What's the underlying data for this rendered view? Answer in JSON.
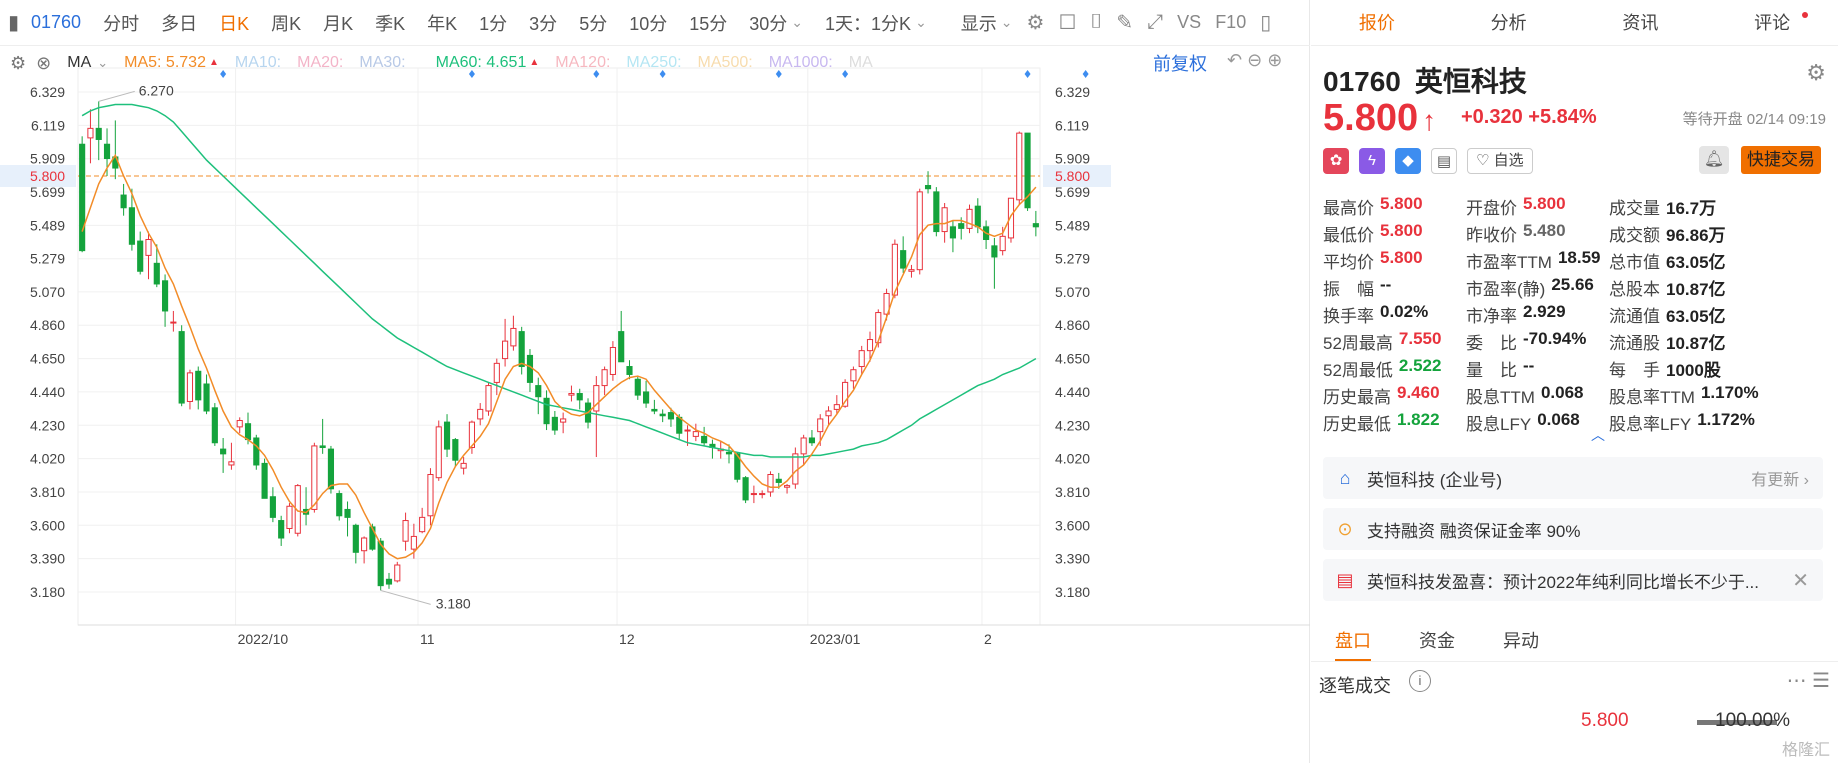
{
  "toolbar": {
    "code": "01760",
    "tabs": [
      "分时",
      "多日",
      "日K",
      "周K",
      "月K",
      "季K",
      "年K",
      "1分",
      "3分",
      "5分",
      "10分",
      "15分",
      "30分"
    ],
    "active": "日K",
    "period": "1天：1分K",
    "display": "显示",
    "vs": "VS",
    "f10": "F10"
  },
  "ma_legend": {
    "type": "MA",
    "ma5": "MA5: 5.732",
    "ma10": "MA10:",
    "ma20": "MA20:",
    "ma30": "MA30:",
    "ma60": "MA60: 4.651",
    "ma120": "MA120:",
    "ma250": "MA250:",
    "ma500": "MA500:",
    "ma1000": "MA1000:",
    "ma_trunc": "MA",
    "fuquan": "前复权",
    "colors": {
      "ma5": "#f28c28",
      "ma10": "#b7d5ef",
      "ma20": "#f3b4c8",
      "ma30": "#b8c9e6",
      "ma60": "#1ec07c",
      "ma120": "#f6b8c0",
      "ma250": "#b5e6f3",
      "ma500": "#f7dcae",
      "ma1000": "#c8b8f0"
    }
  },
  "chart_data": {
    "type": "candlestick",
    "yticks": [
      "6.329",
      "6.119",
      "5.909",
      "5.699",
      "5.489",
      "5.279",
      "5.070",
      "4.860",
      "4.650",
      "4.440",
      "4.230",
      "4.020",
      "3.810",
      "3.600",
      "3.390",
      "3.180"
    ],
    "ylim": [
      3.05,
      6.4
    ],
    "xticks": [
      {
        "label": "2022/10",
        "idx": 19
      },
      {
        "label": "11",
        "idx": 41
      },
      {
        "label": "12",
        "idx": 65
      },
      {
        "label": "2023/01",
        "idx": 88
      },
      {
        "label": "2",
        "idx": 109
      }
    ],
    "current_price_label": "5.800",
    "current_price": 5.8,
    "high_annotation": "6.270",
    "low_annotation": "3.180",
    "candles": [
      [
        6.0,
        6.05,
        5.32,
        5.33
      ],
      [
        6.04,
        6.22,
        5.88,
        6.1
      ],
      [
        6.1,
        6.27,
        5.9,
        6.03
      ],
      [
        6.0,
        6.1,
        5.8,
        5.91
      ],
      [
        5.92,
        6.15,
        5.78,
        5.85
      ],
      [
        5.68,
        5.75,
        5.55,
        5.6
      ],
      [
        5.6,
        5.72,
        5.33,
        5.37
      ],
      [
        5.39,
        5.45,
        5.18,
        5.2
      ],
      [
        5.3,
        5.45,
        5.15,
        5.4
      ],
      [
        5.25,
        5.37,
        5.1,
        5.12
      ],
      [
        5.14,
        5.18,
        4.85,
        4.95
      ],
      [
        4.88,
        4.95,
        4.82,
        4.88
      ],
      [
        4.82,
        4.86,
        4.35,
        4.37
      ],
      [
        4.38,
        4.58,
        4.33,
        4.56
      ],
      [
        4.57,
        4.6,
        4.33,
        4.39
      ],
      [
        4.49,
        4.55,
        4.3,
        4.32
      ],
      [
        4.34,
        4.37,
        4.1,
        4.12
      ],
      [
        4.08,
        4.15,
        3.93,
        4.05
      ],
      [
        3.98,
        4.12,
        3.95,
        4.0
      ],
      [
        4.22,
        4.28,
        4.18,
        4.26
      ],
      [
        4.24,
        4.31,
        4.11,
        4.14
      ],
      [
        4.15,
        4.17,
        3.95,
        3.98
      ],
      [
        3.99,
        4.02,
        3.77,
        3.77
      ],
      [
        3.78,
        3.84,
        3.62,
        3.65
      ],
      [
        3.63,
        3.66,
        3.47,
        3.52
      ],
      [
        3.58,
        3.74,
        3.55,
        3.72
      ],
      [
        3.55,
        3.86,
        3.53,
        3.85
      ],
      [
        3.7,
        3.84,
        3.6,
        3.67
      ],
      [
        3.7,
        4.12,
        3.68,
        4.1
      ],
      [
        4.1,
        4.27,
        4.05,
        4.09
      ],
      [
        4.08,
        4.1,
        3.8,
        3.83
      ],
      [
        3.8,
        3.82,
        3.63,
        3.66
      ],
      [
        3.7,
        3.75,
        3.53,
        3.65
      ],
      [
        3.6,
        3.61,
        3.36,
        3.43
      ],
      [
        3.44,
        3.53,
        3.36,
        3.52
      ],
      [
        3.59,
        3.61,
        3.44,
        3.45
      ],
      [
        3.5,
        3.52,
        3.19,
        3.22
      ],
      [
        3.26,
        3.3,
        3.2,
        3.23
      ],
      [
        3.25,
        3.37,
        3.24,
        3.35
      ],
      [
        3.5,
        3.68,
        3.44,
        3.63
      ],
      [
        3.45,
        3.61,
        3.39,
        3.53
      ],
      [
        3.56,
        3.71,
        3.55,
        3.65
      ],
      [
        3.66,
        3.96,
        3.6,
        3.92
      ],
      [
        3.9,
        4.26,
        3.88,
        4.22
      ],
      [
        4.25,
        4.3,
        4.03,
        4.08
      ],
      [
        4.14,
        4.15,
        3.97,
        4.01
      ],
      [
        3.96,
        4.03,
        3.92,
        3.99
      ],
      [
        4.09,
        4.26,
        4.05,
        4.25
      ],
      [
        4.27,
        4.37,
        4.23,
        4.33
      ],
      [
        4.32,
        4.5,
        4.29,
        4.48
      ],
      [
        4.5,
        4.65,
        4.42,
        4.62
      ],
      [
        4.65,
        4.9,
        4.6,
        4.76
      ],
      [
        4.73,
        4.92,
        4.7,
        4.84
      ],
      [
        4.82,
        4.85,
        4.55,
        4.6
      ],
      [
        4.67,
        4.71,
        4.44,
        4.5
      ],
      [
        4.48,
        4.53,
        4.3,
        4.41
      ],
      [
        4.4,
        4.45,
        4.2,
        4.24
      ],
      [
        4.28,
        4.32,
        4.17,
        4.2
      ],
      [
        4.25,
        4.31,
        4.18,
        4.27
      ],
      [
        4.42,
        4.48,
        4.38,
        4.43
      ],
      [
        4.43,
        4.46,
        4.33,
        4.39
      ],
      [
        4.37,
        4.4,
        4.21,
        4.25
      ],
      [
        4.32,
        4.54,
        4.03,
        4.48
      ],
      [
        4.48,
        4.6,
        4.42,
        4.58
      ],
      [
        4.55,
        4.76,
        4.51,
        4.72
      ],
      [
        4.82,
        4.95,
        4.65,
        4.63
      ],
      [
        4.6,
        4.64,
        4.52,
        4.55
      ],
      [
        4.52,
        4.54,
        4.39,
        4.42
      ],
      [
        4.44,
        4.51,
        4.34,
        4.37
      ],
      [
        4.33,
        4.39,
        4.3,
        4.32
      ],
      [
        4.3,
        4.33,
        4.25,
        4.29
      ],
      [
        4.31,
        4.34,
        4.22,
        4.27
      ],
      [
        4.28,
        4.3,
        4.14,
        4.18
      ],
      [
        4.2,
        4.23,
        4.1,
        4.2
      ],
      [
        4.16,
        4.24,
        4.13,
        4.19
      ],
      [
        4.16,
        4.22,
        4.1,
        4.12
      ],
      [
        4.11,
        4.14,
        4.02,
        4.09
      ],
      [
        4.07,
        4.13,
        4.02,
        4.08
      ],
      [
        4.06,
        4.11,
        3.99,
        4.05
      ],
      [
        4.05,
        4.06,
        3.87,
        3.89
      ],
      [
        3.9,
        3.91,
        3.74,
        3.76
      ],
      [
        3.8,
        3.85,
        3.74,
        3.8
      ],
      [
        3.8,
        3.82,
        3.77,
        3.8
      ],
      [
        3.81,
        3.94,
        3.78,
        3.92
      ],
      [
        3.89,
        3.93,
        3.83,
        3.87
      ],
      [
        3.84,
        3.86,
        3.8,
        3.85
      ],
      [
        3.86,
        4.09,
        3.83,
        4.05
      ],
      [
        4.05,
        4.17,
        3.98,
        4.15
      ],
      [
        4.15,
        4.2,
        4.1,
        4.12
      ],
      [
        4.19,
        4.3,
        4.1,
        4.27
      ],
      [
        4.29,
        4.35,
        4.23,
        4.32
      ],
      [
        4.33,
        4.42,
        4.3,
        4.36
      ],
      [
        4.35,
        4.52,
        4.34,
        4.5
      ],
      [
        4.51,
        4.6,
        4.46,
        4.58
      ],
      [
        4.6,
        4.73,
        4.55,
        4.7
      ],
      [
        4.7,
        4.82,
        4.63,
        4.77
      ],
      [
        4.75,
        4.96,
        4.72,
        4.94
      ],
      [
        4.93,
        5.09,
        4.89,
        5.06
      ],
      [
        5.05,
        5.4,
        5.03,
        5.37
      ],
      [
        5.33,
        5.42,
        5.19,
        5.22
      ],
      [
        5.2,
        5.24,
        5.16,
        5.21
      ],
      [
        5.21,
        5.72,
        5.18,
        5.7
      ],
      [
        5.74,
        5.83,
        5.69,
        5.72
      ],
      [
        5.7,
        5.73,
        5.42,
        5.45
      ],
      [
        5.45,
        5.63,
        5.38,
        5.6
      ],
      [
        5.48,
        5.52,
        5.32,
        5.41
      ],
      [
        5.5,
        5.54,
        5.4,
        5.47
      ],
      [
        5.47,
        5.62,
        5.44,
        5.59
      ],
      [
        5.61,
        5.66,
        5.44,
        5.48
      ],
      [
        5.48,
        5.52,
        5.34,
        5.4
      ],
      [
        5.36,
        5.41,
        5.09,
        5.29
      ],
      [
        5.33,
        5.48,
        5.3,
        5.42
      ],
      [
        5.41,
        5.66,
        5.38,
        5.66
      ],
      [
        5.65,
        6.08,
        5.62,
        6.07
      ],
      [
        6.07,
        6.07,
        5.58,
        5.6
      ],
      [
        5.5,
        5.58,
        5.42,
        5.48
      ]
    ],
    "ma5": [
      5.45,
      5.6,
      5.75,
      5.85,
      5.93,
      5.8,
      5.69,
      5.55,
      5.44,
      5.35,
      5.22,
      5.12,
      4.98,
      4.85,
      4.71,
      4.59,
      4.45,
      4.32,
      4.22,
      4.17,
      4.14,
      4.1,
      4.04,
      3.95,
      3.84,
      3.75,
      3.69,
      3.68,
      3.73,
      3.8,
      3.85,
      3.86,
      3.86,
      3.79,
      3.68,
      3.58,
      3.48,
      3.42,
      3.39,
      3.4,
      3.43,
      3.49,
      3.58,
      3.74,
      3.87,
      3.97,
      4.04,
      4.1,
      4.16,
      4.24,
      4.38,
      4.52,
      4.6,
      4.62,
      4.6,
      4.56,
      4.48,
      4.38,
      4.33,
      4.3,
      4.29,
      4.31,
      4.36,
      4.41,
      4.46,
      4.5,
      4.53,
      4.54,
      4.52,
      4.45,
      4.39,
      4.33,
      4.28,
      4.24,
      4.2,
      4.18,
      4.15,
      4.13,
      4.1,
      4.04,
      3.97,
      3.91,
      3.86,
      3.84,
      3.84,
      3.88,
      3.94,
      3.98,
      4.05,
      4.13,
      4.23,
      4.3,
      4.38,
      4.45,
      4.55,
      4.64,
      4.76,
      4.91,
      5.07,
      5.18,
      5.29,
      5.43,
      5.49,
      5.5,
      5.5,
      5.52,
      5.52,
      5.5,
      5.48,
      5.44,
      5.42,
      5.44,
      5.55,
      5.62,
      5.67,
      5.73
    ],
    "ma60": [
      6.18,
      6.21,
      6.23,
      6.24,
      6.25,
      6.25,
      6.25,
      6.24,
      6.23,
      6.21,
      6.18,
      6.14,
      6.08,
      6.02,
      5.96,
      5.9,
      5.85,
      5.8,
      5.75,
      5.7,
      5.65,
      5.6,
      5.55,
      5.5,
      5.45,
      5.4,
      5.35,
      5.3,
      5.25,
      5.2,
      5.15,
      5.1,
      5.05,
      5.0,
      4.95,
      4.9,
      4.86,
      4.82,
      4.78,
      4.75,
      4.72,
      4.69,
      4.66,
      4.63,
      4.6,
      4.58,
      4.56,
      4.54,
      4.52,
      4.5,
      4.48,
      4.46,
      4.44,
      4.42,
      4.4,
      4.38,
      4.36,
      4.35,
      4.34,
      4.33,
      4.32,
      4.31,
      4.3,
      4.29,
      4.28,
      4.27,
      4.26,
      4.24,
      4.22,
      4.2,
      4.18,
      4.16,
      4.14,
      4.12,
      4.11,
      4.1,
      4.09,
      4.08,
      4.07,
      4.06,
      4.05,
      4.04,
      4.04,
      4.03,
      4.03,
      4.03,
      4.03,
      4.03,
      4.04,
      4.04,
      4.05,
      4.06,
      4.07,
      4.08,
      4.1,
      4.11,
      4.12,
      4.14,
      4.17,
      4.2,
      4.23,
      4.27,
      4.3,
      4.33,
      4.36,
      4.39,
      4.42,
      4.45,
      4.48,
      4.5,
      4.52,
      4.55,
      4.57,
      4.59,
      4.62,
      4.65
    ]
  },
  "stock": {
    "code": "01760",
    "name": "英恒科技",
    "price": "5.800",
    "arrow": "↑",
    "change": "+0.320",
    "change_pct": "+5.84%",
    "status": "等待开盘 02/14 09:19",
    "zixuan": "自选",
    "quick_trade": "快捷交易"
  },
  "tabs": [
    "报价",
    "分析",
    "资讯",
    "评论"
  ],
  "stats": [
    [
      {
        "k": "最高价",
        "v": "5.800",
        "c": "red"
      },
      {
        "k": "开盘价",
        "v": "5.800",
        "c": "red"
      },
      {
        "k": "成交量",
        "v": "16.7万",
        "c": ""
      }
    ],
    [
      {
        "k": "最低价",
        "v": "5.800",
        "c": "red"
      },
      {
        "k": "昨收价",
        "v": "5.480",
        "c": "gray"
      },
      {
        "k": "成交额",
        "v": "96.86万",
        "c": ""
      }
    ],
    [
      {
        "k": "平均价",
        "v": "5.800",
        "c": "red"
      },
      {
        "k": "市盈率TTM",
        "v": "18.59",
        "c": ""
      },
      {
        "k": "总市值",
        "v": "63.05亿",
        "c": ""
      }
    ],
    [
      {
        "k": "振　幅",
        "v": "--",
        "c": ""
      },
      {
        "k": "市盈率(静)",
        "v": "25.66",
        "c": ""
      },
      {
        "k": "总股本",
        "v": "10.87亿",
        "c": ""
      }
    ],
    [
      {
        "k": "换手率",
        "v": "0.02%",
        "c": ""
      },
      {
        "k": "市净率",
        "v": "2.929",
        "c": ""
      },
      {
        "k": "流通值",
        "v": "63.05亿",
        "c": ""
      }
    ],
    [
      {
        "k": "52周最高",
        "v": "7.550",
        "c": "red"
      },
      {
        "k": "委　比",
        "v": "-70.94%",
        "c": ""
      },
      {
        "k": "流通股",
        "v": "10.87亿",
        "c": ""
      }
    ],
    [
      {
        "k": "52周最低",
        "v": "2.522",
        "c": "green"
      },
      {
        "k": "量　比",
        "v": "--",
        "c": ""
      },
      {
        "k": "每　手",
        "v": "1000股",
        "c": ""
      }
    ],
    [
      {
        "k": "历史最高",
        "v": "9.460",
        "c": "red"
      },
      {
        "k": "股息TTM",
        "v": "0.068",
        "c": ""
      },
      {
        "k": "股息率TTM",
        "v": "1.170%",
        "c": ""
      }
    ],
    [
      {
        "k": "历史最低",
        "v": "1.822",
        "c": "green"
      },
      {
        "k": "股息LFY",
        "v": "0.068",
        "c": ""
      },
      {
        "k": "股息率LFY",
        "v": "1.172%",
        "c": ""
      }
    ]
  ],
  "cards": {
    "company": "英恒科技 (企业号)",
    "company_right": "有更新",
    "margin": "支持融资 融资保证金率 90%",
    "news": "英恒科技发盈喜：预计2022年纯利同比增长不少于..."
  },
  "subtabs": [
    "盘口",
    "资金",
    "异动"
  ],
  "zhubi": {
    "title": "逐笔成交",
    "price": "5.800",
    "pct": "100.00%"
  },
  "watermark": "格隆汇"
}
